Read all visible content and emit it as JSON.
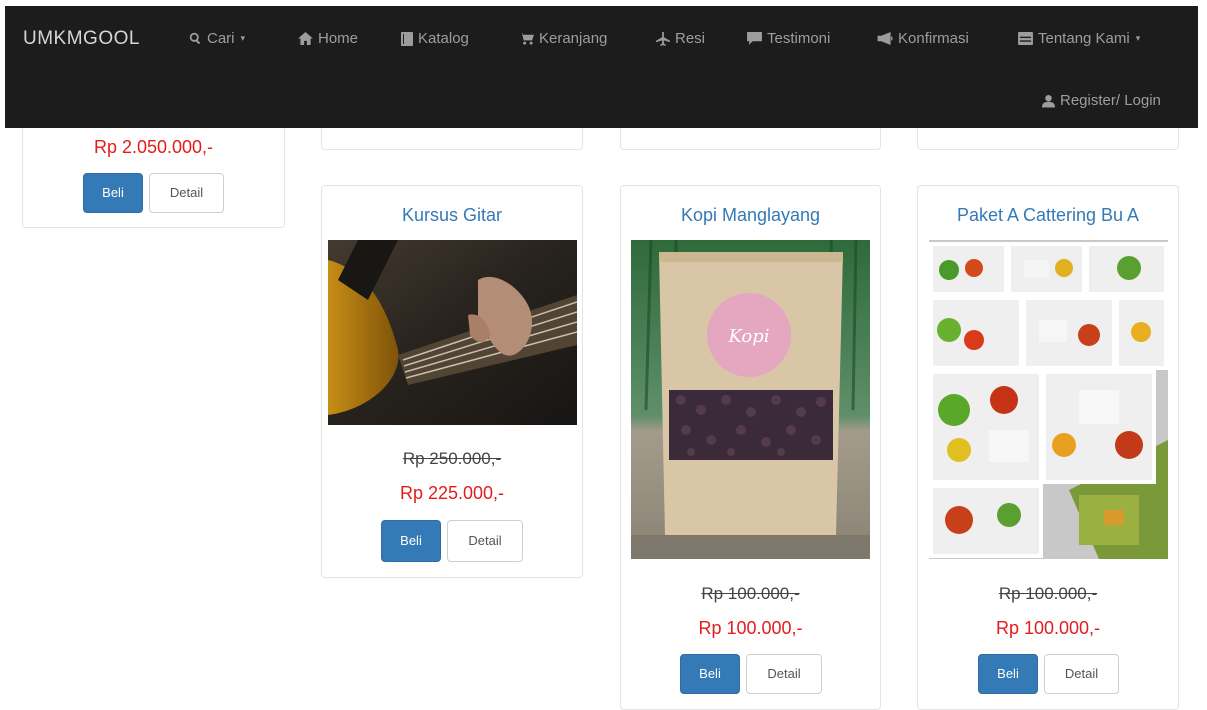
{
  "navbar": {
    "brand": "UMKMGOOL",
    "items": [
      {
        "label": "Cari",
        "icon": "search-icon",
        "caret": "▾"
      },
      {
        "label": "Home",
        "icon": "home-icon"
      },
      {
        "label": "Katalog",
        "icon": "book-icon"
      },
      {
        "label": "Keranjang",
        "icon": "cart-icon"
      },
      {
        "label": "Resi",
        "icon": "plane-icon"
      },
      {
        "label": "Testimoni",
        "icon": "comment-icon"
      },
      {
        "label": "Konfirmasi",
        "icon": "bullhorn-icon"
      },
      {
        "label": "Tentang Kami",
        "icon": "inbox-icon",
        "caret": "▾"
      }
    ],
    "login": {
      "label": "Register/ Login",
      "icon": "user-icon"
    }
  },
  "products": {
    "first": {
      "price_new": "Rp 2.050.000,-",
      "buy_label": "Beli",
      "detail_label": "Detail"
    },
    "gitar": {
      "title": "Kursus Gitar",
      "price_old": "Rp 250.000,-",
      "price_new": "Rp 225.000,-",
      "buy_label": "Beli",
      "detail_label": "Detail"
    },
    "kopi": {
      "title": "Kopi Manglayang",
      "price_old": "Rp 100.000,-",
      "price_new": "Rp 100.000,-",
      "buy_label": "Beli",
      "detail_label": "Detail",
      "pack_text": "Kopi"
    },
    "catering": {
      "title": "Paket A Cattering Bu A",
      "price_old": "Rp 100.000,-",
      "price_new": "Rp 100.000,-",
      "buy_label": "Beli",
      "detail_label": "Detail"
    }
  },
  "colors": {
    "navbar": "#1c1c1c",
    "link": "#337ab7",
    "price_new": "#e41c1c",
    "button_primary": "#337ab7"
  }
}
